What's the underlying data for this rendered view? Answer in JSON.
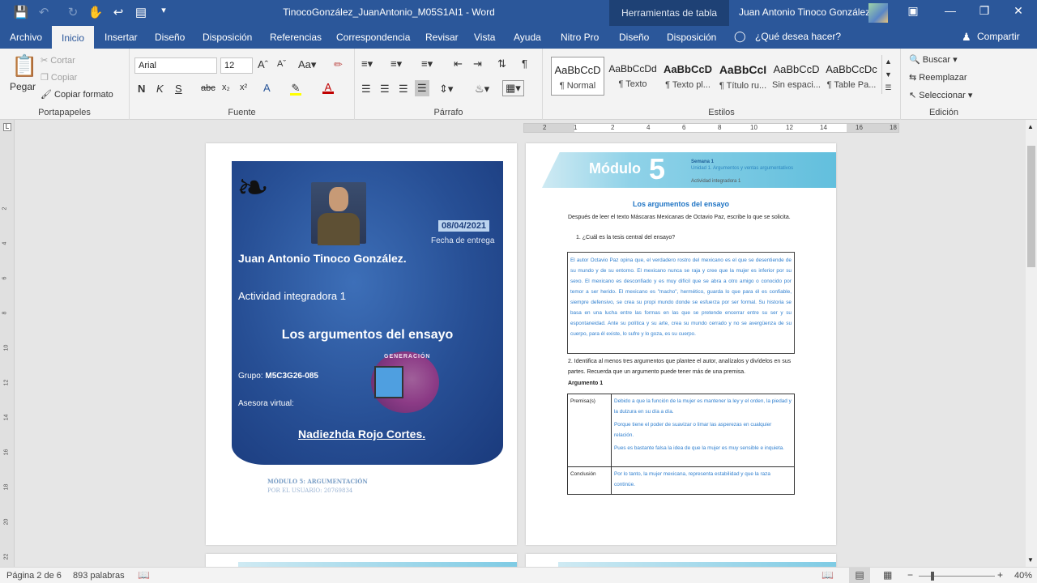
{
  "titlebar": {
    "doc_title": "TinocoGonzález_JuanAntonio_M05S1AI1  -  Word",
    "context_tools": "Herramientas de tabla",
    "user": "Juan Antonio Tinoco González"
  },
  "tabs": [
    "Archivo",
    "Inicio",
    "Insertar",
    "Diseño",
    "Disposición",
    "Referencias",
    "Correspondencia",
    "Revisar",
    "Vista",
    "Ayuda",
    "Nitro Pro",
    "Diseño",
    "Disposición"
  ],
  "tell_me": "¿Qué desea hacer?",
  "share": "Compartir",
  "ribbon": {
    "clipboard": {
      "paste": "Pegar",
      "cut": "Cortar",
      "copy": "Copiar",
      "format_painter": "Copiar formato",
      "group": "Portapapeles"
    },
    "font": {
      "family": "Arial",
      "size": "12",
      "group": "Fuente"
    },
    "paragraph": {
      "group": "Párrafo"
    },
    "styles": {
      "group": "Estilos",
      "items": [
        {
          "preview": "AaBbCcD",
          "name": "¶ Normal"
        },
        {
          "preview": "AaBbCcDd",
          "name": "¶ Texto"
        },
        {
          "preview": "AaBbCcD",
          "name": "¶ Texto pl..."
        },
        {
          "preview": "AaBbCcI",
          "name": "¶ Título ru..."
        },
        {
          "preview": "AaBbCcD",
          "name": "Sin espaci..."
        },
        {
          "preview": "AaBbCcDc",
          "name": "¶ Table Pa..."
        }
      ]
    },
    "editing": {
      "find": "Buscar",
      "replace": "Reemplazar",
      "select": "Seleccionar",
      "group": "Edición"
    }
  },
  "ruler": {
    "labels": [
      "2",
      "1",
      "2",
      "4",
      "6",
      "8",
      "10",
      "12",
      "14",
      "16",
      "18"
    ]
  },
  "vruler": {
    "labels": [
      "2",
      "4",
      "6",
      "8",
      "10",
      "12",
      "14",
      "16",
      "18",
      "20",
      "22"
    ]
  },
  "cover": {
    "date": "08/04/2021",
    "date_caption": "Fecha de entrega",
    "name": "Juan Antonio Tinoco González.",
    "activity": "Actividad integradora 1",
    "title": "Los argumentos del ensayo",
    "group_label": "Grupo: ",
    "group_value": "M5C3G26-085",
    "advisor_label": "Asesora virtual:",
    "advisor_name": "Nadiezhda Rojo Cortes.",
    "logo_text": "GENERACIÓN",
    "footer1": "MÓDULO 5: ARGUMENTACIÓN",
    "footer2": "POR EL USUARIO: 20769834"
  },
  "page2": {
    "module": "Módulo",
    "module_num": "5",
    "semana": "Semana 1",
    "unidad": "Unidad 1. Argumentos y ventas argumentativos",
    "actividad": "Actividad integradora 1",
    "heading": "Los argumentos del ensayo",
    "intro": "Después de leer el texto Máscaras Mexicanas de Octavio Paz, escribe lo que se solicita.",
    "q1": "1.    ¿Cuál es la tesis central del ensayo?",
    "answer1": "El autor Octavio Paz opina que, el verdadero rostro del mexicano es el que se desentiende de su mundo y de su entorno. El mexicano nunca se raja y cree que la mujer es inferior por su sexo. El mexicano es desconfiado y es muy difícil que se abra a otro amigo o conocido por temor a ser herido. El mexicano es \"macho\", hermético, guarda lo que para él es confiable, siempre defensivo, se crea su propi mundo donde se esfuerza por ser formal. Su historia se basa en una lucha entre las formas en las que se pretende encerrar entre su ser y su espontaneidad. Ante su política y su arte, crea su mundo cerrado y no se avergüenza de su cuerpo, para él existe, lo sufre y lo goza, es su cuerpo.",
    "q2": "2. Identifica al menos tres argumentos que plantee el autor, analízalos y divídelos en sus partes. Recuerda que un argumento puede tener más de una premisa.",
    "arg_label": "Argumento 1",
    "premise_label": "Premisa(s)",
    "premises": [
      "Debido a que la función de la mujer es mantener la ley y el orden, la piedad y la dulzura en su día a día.",
      "Porque tiene el poder de suavizar o limar las asperezas en cualquier relación.",
      "Pues es bastante falsa la idea de que la mujer es muy sensible e inquieta."
    ],
    "conclusion_label": "Conclusión",
    "conclusion": "Por lo tanto, la mujer mexicana, representa estabilidad y que la raza continúe."
  },
  "status": {
    "page": "Página 2 de 6",
    "words": "893 palabras",
    "zoom": "40%"
  },
  "colors": {
    "brand": "#2b579a",
    "answer_text": "#2f7fcf",
    "heading_blue": "#1f74c4"
  }
}
